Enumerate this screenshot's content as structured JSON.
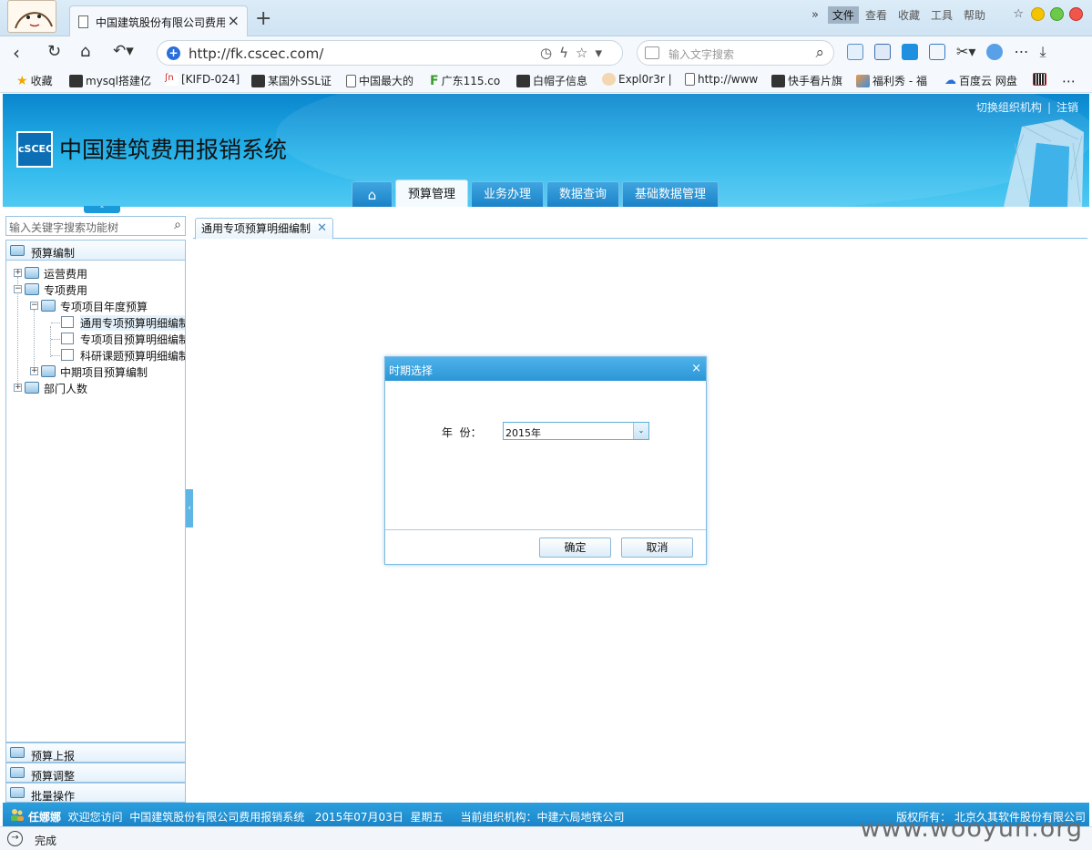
{
  "browser": {
    "tab_title": "中国建筑股份有限公司费用",
    "menu": [
      "文件",
      "查看",
      "收藏",
      "工具",
      "帮助"
    ],
    "url": "http://fk.cscec.com/",
    "search_placeholder": "输入文字搜索",
    "bookmarks": [
      "收藏",
      "mysql搭建亿",
      "[KIFD-024]",
      "某国外SSL证",
      "中国最大的",
      "广东115.co",
      "白帽子信息",
      "Expl0r3r |",
      "http://www",
      "快手看片旗",
      "福利秀 - 福",
      "百度云 网盘"
    ],
    "status_text": "完成",
    "watermark": "www.wooyun.org"
  },
  "app": {
    "title": "中国建筑费用报销系统",
    "logo_text": "cSCEC",
    "header_links": [
      "切换组织机构",
      "注销"
    ],
    "main_tabs": [
      "预算管理",
      "业务办理",
      "数据查询",
      "基础数据管理"
    ],
    "active_main_tab": "预算管理"
  },
  "sidebar": {
    "search_placeholder": "输入关键字搜索功能树",
    "top_section": "预算编制",
    "tree": {
      "n1": "运营费用",
      "n2": "专项费用",
      "n2_1": "专项项目年度预算",
      "n2_1_1": "通用专项预算明细编制",
      "n2_1_2": "专项项目预算明细编制",
      "n2_1_3": "科研课题预算明细编制",
      "n2_2": "中期项目预算编制",
      "n3": "部门人数"
    },
    "bottom_sections": [
      "预算上报",
      "预算调整",
      "批量操作"
    ]
  },
  "content": {
    "tab_label": "通用专项预算明细编制"
  },
  "dialog": {
    "title": "时期选择",
    "field_label": "年  份：",
    "year_value": "2015年",
    "ok_label": "确定",
    "cancel_label": "取消"
  },
  "status": {
    "user": "任娜娜",
    "welcome": "欢迎您访问  中国建筑股份有限公司费用报销系统",
    "date": "2015年07月03日  星期五",
    "org": "当前组织机构：中建六局地铁公司",
    "copyright": "版权所有：  北京久其软件股份有限公司"
  },
  "colors": {
    "header_blue": "#28b4ea",
    "status_blue": "#2b9fde",
    "dialog_title_blue": "#2b96d6"
  }
}
